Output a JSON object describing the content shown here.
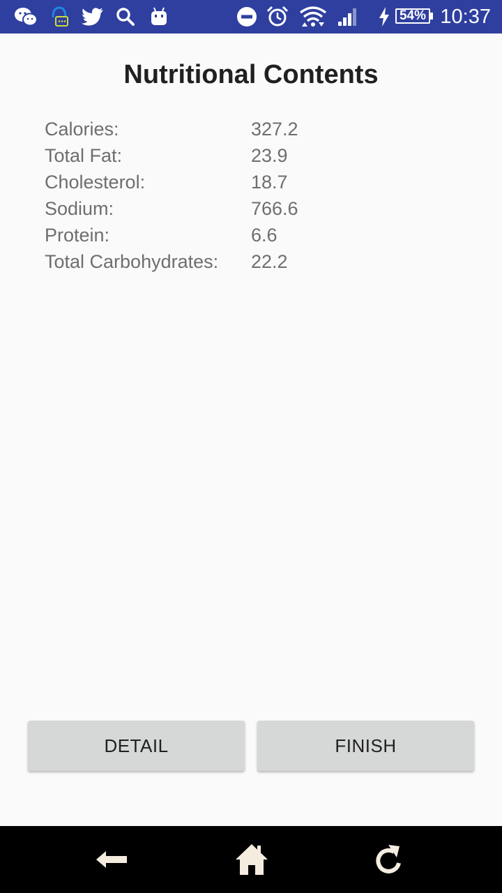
{
  "status_bar": {
    "icons": [
      "wechat-icon",
      "chat-bubble-icon",
      "twitter-icon",
      "search-icon",
      "android-icon",
      "do-not-disturb-icon",
      "alarm-icon",
      "wifi-icon",
      "signal-icon",
      "charging-icon"
    ],
    "battery": "54%",
    "time": "10:37",
    "color": "#2f3f9f"
  },
  "page": {
    "title": "Nutritional Contents"
  },
  "nutrition": [
    {
      "label": "Calories:",
      "value": "327.2"
    },
    {
      "label": "Total Fat:",
      "value": "23.9"
    },
    {
      "label": "Cholesterol:",
      "value": "18.7"
    },
    {
      "label": "Sodium:",
      "value": "766.6"
    },
    {
      "label": "Protein:",
      "value": "6.6"
    },
    {
      "label": "Total Carbohydrates:",
      "value": "22.2"
    }
  ],
  "buttons": {
    "detail": "DETAIL",
    "finish": "FINISH"
  },
  "nav_bar": {
    "icons": [
      "back-arrow-icon",
      "home-icon",
      "refresh-icon"
    ]
  }
}
